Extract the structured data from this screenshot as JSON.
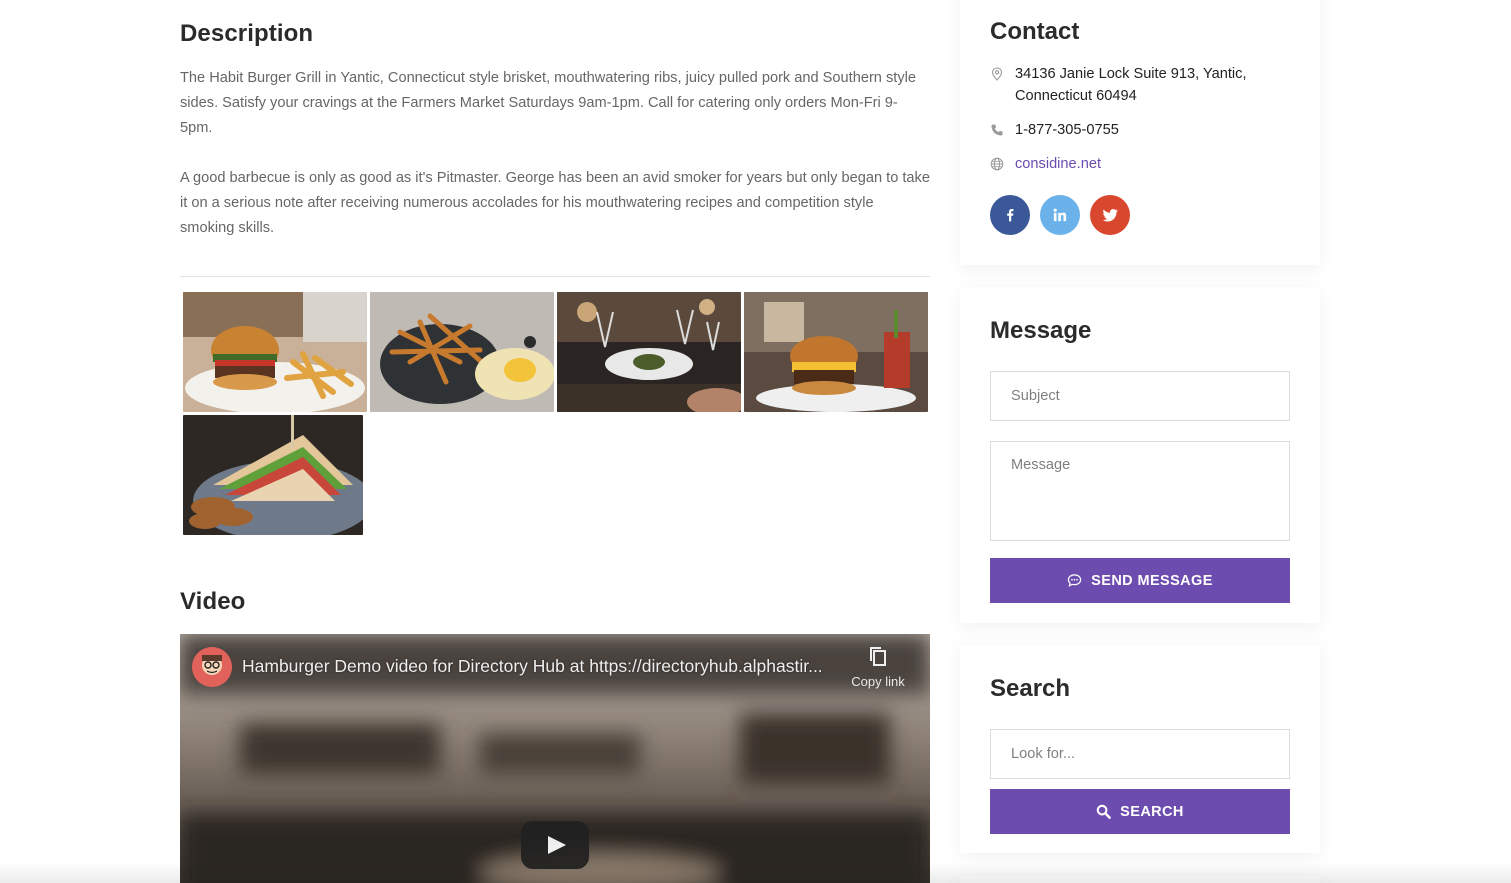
{
  "description": {
    "title": "Description",
    "paragraphs": [
      "The Habit Burger Grill in Yantic, Connecticut style brisket, mouthwatering ribs, juicy pulled pork and Southern style sides. Satisfy your cravings at the Farmers Market Saturdays 9am-1pm. Call for catering only orders Mon-Fri 9-5pm.",
      "A good barbecue is only as good as it's Pitmaster. George has been an avid smoker for years but only began to take it on a serious note after receiving numerous accolades for his mouthwatering recipes and competition style smoking skills."
    ]
  },
  "gallery": {
    "images": [
      {
        "subject": "burger with fries on plate"
      },
      {
        "subject": "fries in bowl with egg"
      },
      {
        "subject": "restaurant table with plated dish"
      },
      {
        "subject": "burger with drink in restaurant"
      },
      {
        "subject": "club sandwich with chips"
      }
    ]
  },
  "video": {
    "title": "Video",
    "video_title": "Hamburger Demo video for Directory Hub at https://directoryhub.alphastir...",
    "copy_link_label": "Copy link"
  },
  "contact": {
    "title": "Contact",
    "address": "34136 Janie Lock Suite 913, Yantic, Connecticut 60494",
    "phone": "1-877-305-0755",
    "website": "considine.net",
    "social": [
      {
        "name": "facebook",
        "glyph": "f",
        "color": "#3b5998"
      },
      {
        "name": "linkedin",
        "glyph": "in",
        "color": "#6cb2ea"
      },
      {
        "name": "twitter",
        "glyph": "t",
        "color": "#d9472f"
      }
    ]
  },
  "message": {
    "title": "Message",
    "subject_placeholder": "Subject",
    "message_placeholder": "Message",
    "send_label": "SEND MESSAGE"
  },
  "search": {
    "title": "Search",
    "placeholder": "Look for...",
    "button_label": "SEARCH"
  },
  "colors": {
    "accent": "#6d4caf",
    "link": "#6a4caf",
    "facebook": "#3b5998",
    "linkedin": "#6cb2ea",
    "twitter": "#d9472f"
  }
}
